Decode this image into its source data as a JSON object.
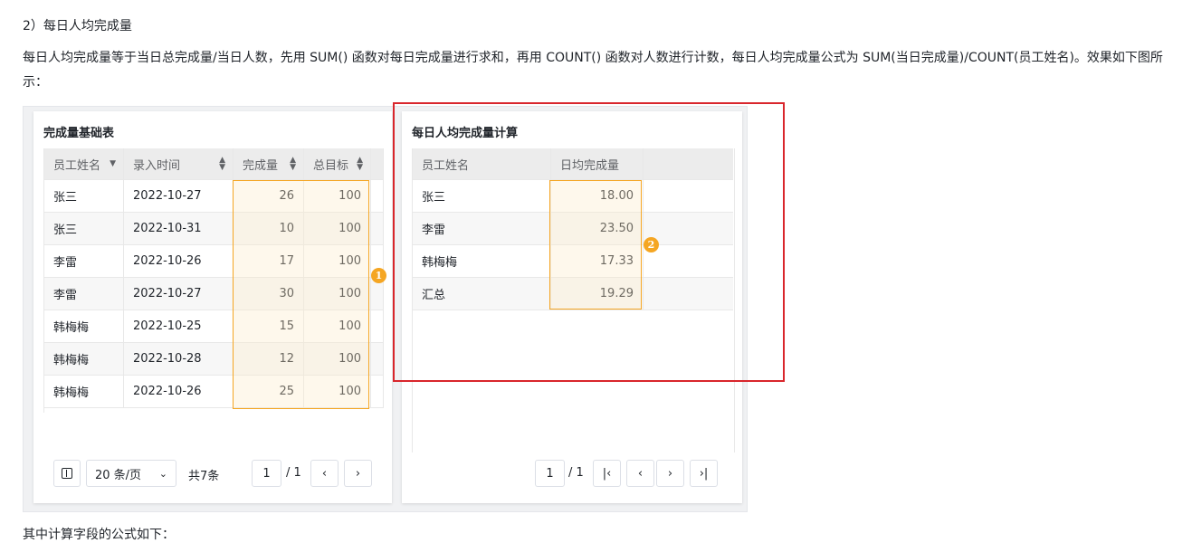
{
  "heading": "2）每日人均完成量",
  "paragraph": "每日人均完成量等于当日总完成量/当日人数，先用 SUM() 函数对每日完成量进行求和，再用 COUNT() 函数对人数进行计数，每日人均完成量公式为 SUM(当日完成量)/COUNT(员工姓名)。效果如下图所示：",
  "cutoff_text": "其中计算字段的公式如下：",
  "left_panel": {
    "title": "完成量基础表",
    "columns": [
      "员工姓名",
      "录入时间",
      "完成量",
      "总目标"
    ],
    "rows": [
      [
        "张三",
        "2022-10-27",
        "26",
        "100"
      ],
      [
        "张三",
        "2022-10-31",
        "10",
        "100"
      ],
      [
        "李雷",
        "2022-10-26",
        "17",
        "100"
      ],
      [
        "李雷",
        "2022-10-27",
        "30",
        "100"
      ],
      [
        "韩梅梅",
        "2022-10-25",
        "15",
        "100"
      ],
      [
        "韩梅梅",
        "2022-10-28",
        "12",
        "100"
      ],
      [
        "韩梅梅",
        "2022-10-26",
        "25",
        "100"
      ]
    ],
    "badge": "1",
    "pager": {
      "page_size": "20 条/页",
      "total": "共7条",
      "current_page": "1",
      "page_count": "/ 1"
    }
  },
  "right_panel": {
    "title": "每日人均完成量计算",
    "columns": [
      "员工姓名",
      "日均完成量"
    ],
    "rows": [
      [
        "张三",
        "18.00"
      ],
      [
        "李雷",
        "23.50"
      ],
      [
        "韩梅梅",
        "17.33"
      ],
      [
        "汇总",
        "19.29"
      ]
    ],
    "badge": "2",
    "pager": {
      "current_page": "1",
      "page_count": "/ 1"
    }
  },
  "colors": {
    "highlight": "#f5a623",
    "annotation_box": "#d9262c",
    "header_bg": "#ececec"
  }
}
